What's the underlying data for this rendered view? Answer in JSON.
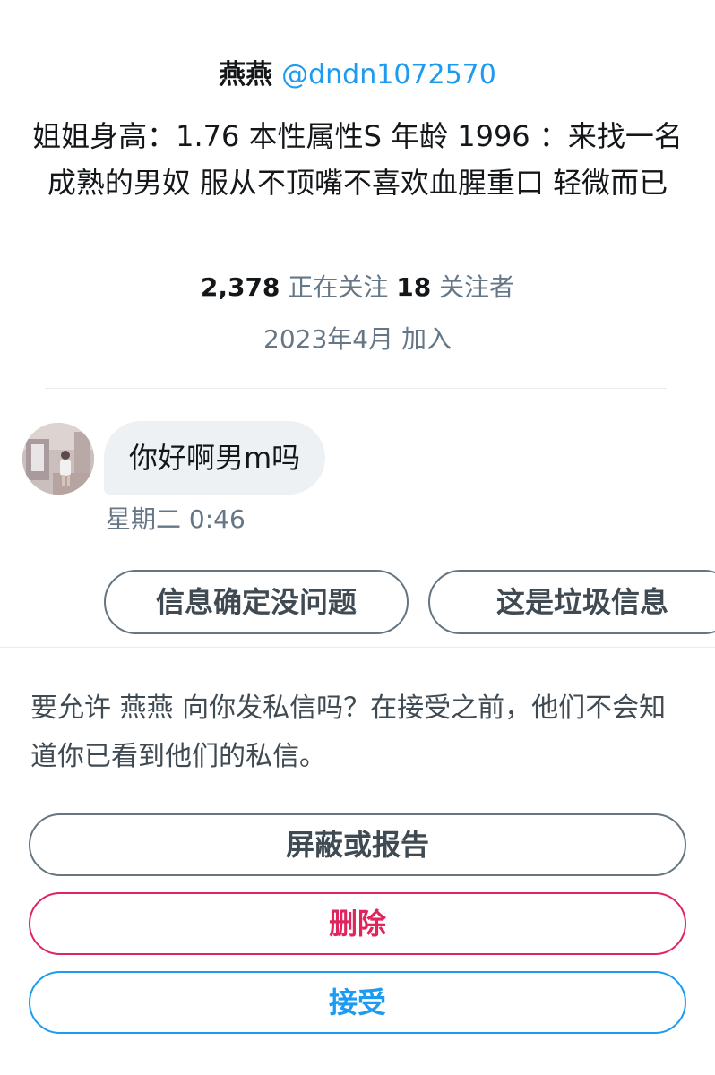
{
  "profile": {
    "display_name": "燕燕",
    "handle": "@dndn1072570",
    "bio": "姐姐身高：1.76 本性属性S 年龄 1996 ：来找一名成熟的男奴 服从不顶嘴不喜欢血腥重口 轻微而已",
    "following_count": "2,378",
    "following_label": "正在关注",
    "followers_count": "18",
    "followers_label": "关注者",
    "joined": "2023年4月 加入"
  },
  "message": {
    "text": "你好啊男m吗",
    "time": "星期二 0:46"
  },
  "quick_replies": [
    {
      "label": "信息确定没问题"
    },
    {
      "label": "这是垃圾信息"
    }
  ],
  "request": {
    "prompt": "要允许 燕燕 向你发私信吗？在接受之前，他们不会知道你已看到他们的私信。",
    "block_label": "屏蔽或报告",
    "delete_label": "删除",
    "accept_label": "接受"
  },
  "colors": {
    "accent": "#1d9bf0",
    "danger": "#e0245e",
    "muted": "#657786",
    "bubble": "#eef1f3"
  }
}
